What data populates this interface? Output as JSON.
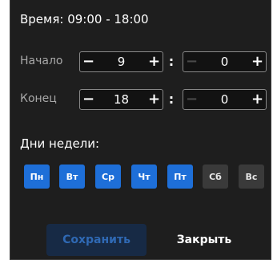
{
  "title": "Время: 09:00 - 18:00",
  "start": {
    "label": "Начало",
    "hours": "9",
    "minutes": "0",
    "minus": "−",
    "plus": "+",
    "separator": ":"
  },
  "end": {
    "label": "Конец",
    "hours": "18",
    "minutes": "0",
    "minus": "−",
    "plus": "+",
    "separator": ":"
  },
  "days_title": "Дни недели:",
  "days": [
    {
      "label": "Пн",
      "selected": true
    },
    {
      "label": "Вт",
      "selected": true
    },
    {
      "label": "Ср",
      "selected": true
    },
    {
      "label": "Чт",
      "selected": true
    },
    {
      "label": "Пт",
      "selected": true
    },
    {
      "label": "Сб",
      "selected": false
    },
    {
      "label": "Вс",
      "selected": false
    }
  ],
  "actions": {
    "save": "Сохранить",
    "close": "Закрыть"
  },
  "colors": {
    "accent": "#1e6fd8",
    "panel": "#1e1e1e",
    "save_disabled_text": "#2f69b4"
  }
}
